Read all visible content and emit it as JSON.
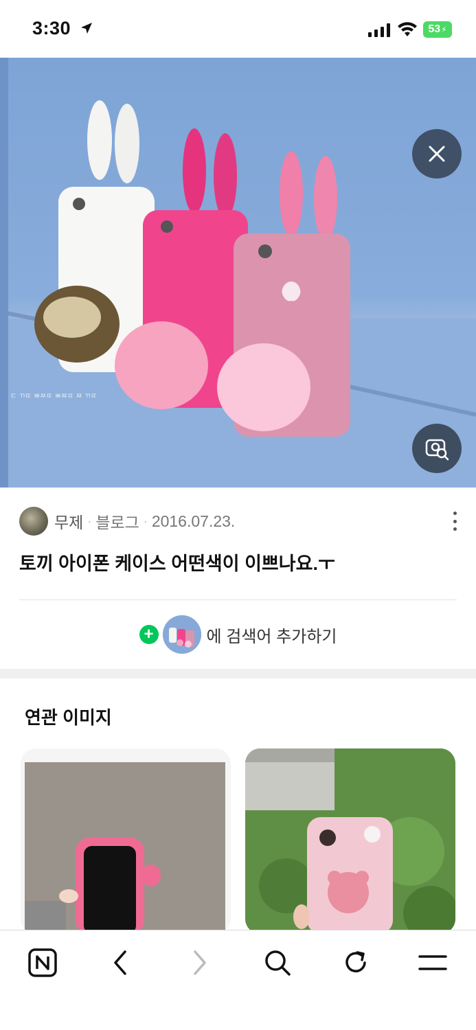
{
  "status_bar": {
    "time": "3:30",
    "battery": "53"
  },
  "hero": {
    "description_icon": "image-photo"
  },
  "source": {
    "name": "무제",
    "type": "블로그",
    "date": "2016.07.23.",
    "separator": "·"
  },
  "post": {
    "title": "토끼 아이폰 케이스 어떤색이 이쁘나요.ㅜ"
  },
  "add_search": {
    "plus": "+",
    "label": "에 검색어 추가하기"
  },
  "related": {
    "title": "연관 이미지"
  },
  "toolbar": {
    "items": [
      "naver-home-icon",
      "back-icon",
      "forward-icon",
      "search-icon",
      "refresh-icon",
      "menu-icon"
    ]
  },
  "colors": {
    "accent_green": "#03c75a",
    "battery_green": "#4cd964",
    "overlay_button": "#2d3746"
  }
}
